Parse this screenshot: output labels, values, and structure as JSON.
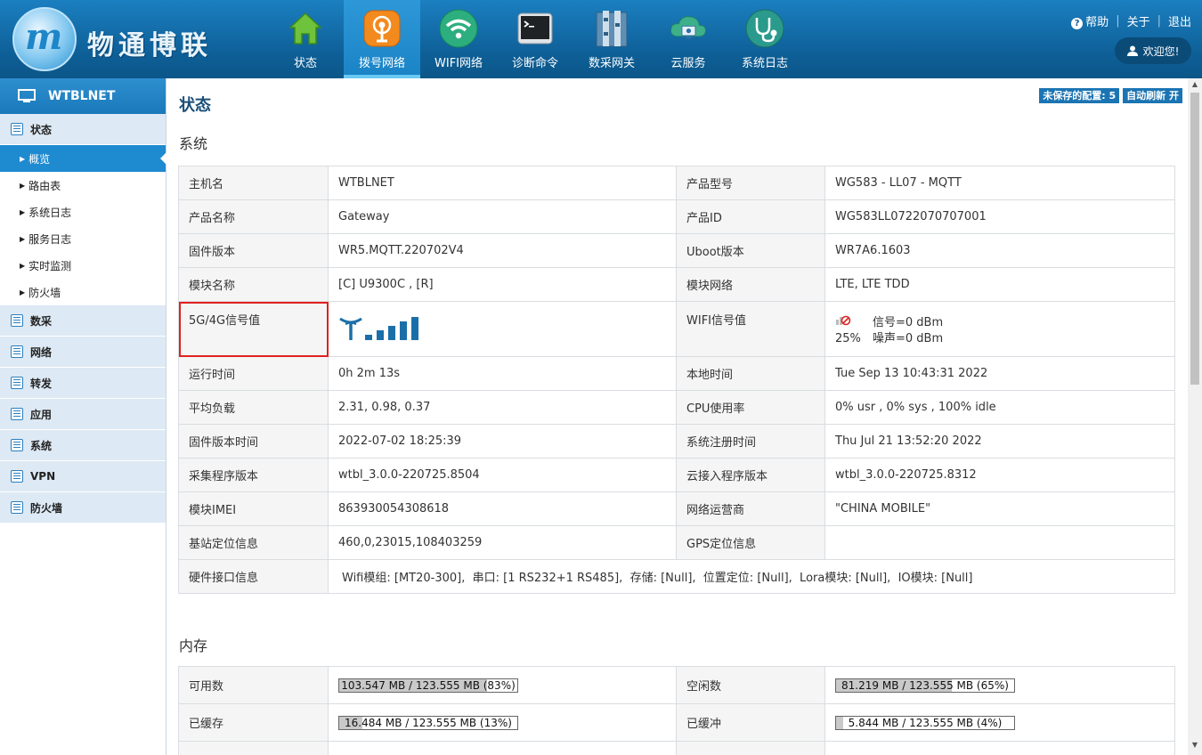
{
  "brand": {
    "logo_mark": "m",
    "name": "物通博联"
  },
  "nav": [
    {
      "label": "状态",
      "icon": "home-icon"
    },
    {
      "label": "拨号网络",
      "icon": "dialup-icon",
      "active": true
    },
    {
      "label": "WIFI网络",
      "icon": "wifi-icon"
    },
    {
      "label": "诊断命令",
      "icon": "terminal-icon"
    },
    {
      "label": "数采网关",
      "icon": "gateway-icon"
    },
    {
      "label": "云服务",
      "icon": "cloud-icon"
    },
    {
      "label": "系统日志",
      "icon": "stethoscope-icon"
    }
  ],
  "topright": {
    "help": "帮助",
    "about": "关于",
    "logout": "退出",
    "welcome": "欢迎您!"
  },
  "sidebar": {
    "device": "WTBLNET",
    "groups": [
      {
        "label": "状态",
        "items": [
          "概览",
          "路由表",
          "系统日志",
          "服务日志",
          "实时监测",
          "防火墙"
        ],
        "active_item": "概览"
      },
      {
        "label": "数采"
      },
      {
        "label": "网络"
      },
      {
        "label": "转发"
      },
      {
        "label": "应用"
      },
      {
        "label": "系统"
      },
      {
        "label": "VPN"
      },
      {
        "label": "防火墙"
      }
    ]
  },
  "main": {
    "title": "状态",
    "badges": {
      "unsaved": "未保存的配置: 5",
      "autorefresh": "自动刷新 开"
    },
    "system_title": "系统",
    "system_rows": [
      [
        "主机名",
        "WTBLNET",
        "产品型号",
        "WG583 - LL07 - MQTT"
      ],
      [
        "产品名称",
        "Gateway",
        "产品ID",
        "WG583LL0722070707001"
      ],
      [
        "固件版本",
        "WR5.MQTT.220702V4",
        "Uboot版本",
        "WR7A6.1603"
      ],
      [
        "模块名称",
        "[C] U9300C , [R]",
        "模块网络",
        "LTE, LTE TDD"
      ]
    ],
    "signal_row": {
      "label": "5G/4G信号值",
      "bars": 5,
      "wifi_label": "WIFI信号值",
      "wifi_percent": "25%",
      "wifi_signal": "信号=0 dBm",
      "wifi_noise": "噪声=0 dBm"
    },
    "system_rows2": [
      [
        "运行时间",
        "0h 2m 13s",
        "本地时间",
        "Tue Sep 13 10:43:31 2022"
      ],
      [
        "平均负载",
        "2.31, 0.98, 0.37",
        "CPU使用率",
        "0% usr , 0% sys , 100% idle"
      ],
      [
        "固件版本时间",
        "2022-07-02 18:25:39",
        "系统注册时间",
        "Thu Jul 21 13:52:20 2022"
      ],
      [
        "采集程序版本",
        "wtbl_3.0.0-220725.8504",
        "云接入程序版本",
        "wtbl_3.0.0-220725.8312"
      ],
      [
        "模块IMEI",
        "863930054308618",
        "网络运营商",
        "\"CHINA MOBILE\""
      ],
      [
        "基站定位信息",
        "460,0,23015,108403259",
        "GPS定位信息",
        ""
      ]
    ],
    "hw_row": {
      "label": "硬件接口信息",
      "value": "Wifi模组: [MT20-300],  串口: [1 RS232+1 RS485],  存储: [Null],  位置定位: [Null],  Lora模块: [Null],  IO模块: [Null]"
    },
    "memory_title": "内存",
    "memory_rows": [
      {
        "k1": "可用数",
        "v1": "103.547 MB / 123.555 MB (83%)",
        "p1": 0.83,
        "k2": "空闲数",
        "v2": "81.219 MB / 123.555 MB (65%)",
        "p2": 0.65
      },
      {
        "k1": "已缓存",
        "v1": "16.484 MB / 123.555 MB (13%)",
        "p1": 0.13,
        "k2": "已缓冲",
        "v2": "5.844 MB / 123.555 MB (4%)",
        "p2": 0.04
      }
    ]
  }
}
